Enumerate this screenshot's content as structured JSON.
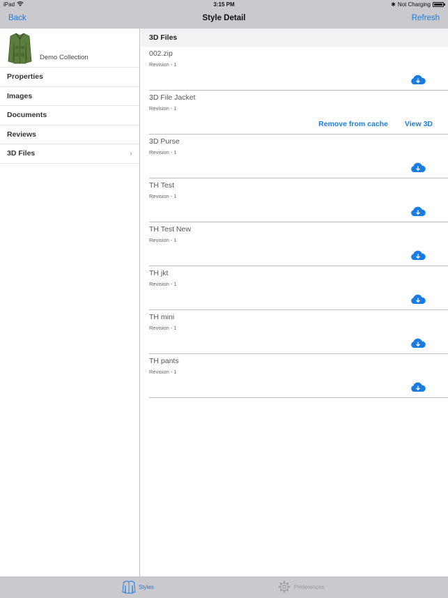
{
  "status_bar": {
    "carrier": "iPad",
    "time": "3:15 PM",
    "battery_text": "Not Charging"
  },
  "nav": {
    "back_label": "Back",
    "title": "Style Detail",
    "refresh_label": "Refresh"
  },
  "sidebar": {
    "collection_name": "Demo Collection",
    "items": [
      {
        "label": "Properties"
      },
      {
        "label": "Images"
      },
      {
        "label": "Documents"
      },
      {
        "label": "Reviews"
      },
      {
        "label": "3D Files"
      }
    ]
  },
  "main": {
    "header": "3D Files",
    "files": [
      {
        "name": "002.zip",
        "revision": "Revision - 1"
      },
      {
        "name": "3D File Jacket",
        "revision": "Revision - 1"
      },
      {
        "name": "3D Purse",
        "revision": "Revision - 1"
      },
      {
        "name": "TH Test",
        "revision": "Revision - 1"
      },
      {
        "name": "TH Test New",
        "revision": "Revision - 1"
      },
      {
        "name": "TH jkt",
        "revision": "Revision - 1"
      },
      {
        "name": "TH mini",
        "revision": "Revision - 1"
      },
      {
        "name": "TH pants",
        "revision": "Revision - 1"
      }
    ],
    "cached_actions": {
      "remove_label": "Remove from cache",
      "view_label": "View 3D"
    }
  },
  "tab_bar": {
    "tabs": [
      {
        "label": "Styles",
        "icon": "jacket-icon",
        "active": true
      },
      {
        "label": "Preferences",
        "icon": "gear-icon",
        "active": false
      }
    ]
  },
  "colors": {
    "accent": "#1a7ce0",
    "bar_background": "#c9c9ce"
  }
}
